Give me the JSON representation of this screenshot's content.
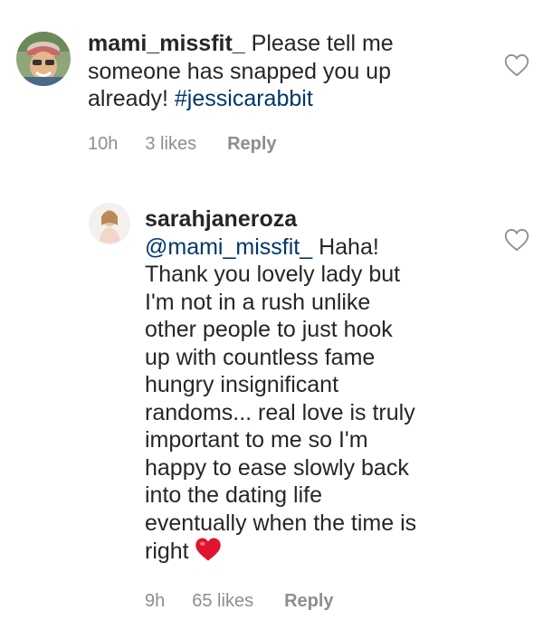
{
  "comments": [
    {
      "username": "mami_missfit_",
      "text_before_tag": "Please tell me",
      "text_line2": "someone has snapped you up",
      "text_line3_prefix": "already!",
      "hashtag": "#jessicarabbit",
      "time": "10h",
      "likes": "3 likes",
      "reply": "Reply"
    },
    {
      "username": "sarahjaneroza",
      "mention": "@mami_missfit_",
      "lines": [
        "Haha!",
        "Thank you lovely lady but",
        "I'm not in a rush unlike",
        "other people to just hook",
        "up with countless fame",
        "hungry insignificant",
        "randoms... real love is truly",
        "important to me so I'm",
        "happy to ease slowly back",
        "into the dating life",
        "eventually when the time is",
        "right"
      ],
      "time": "9h",
      "likes": "65 likes",
      "reply": "Reply"
    }
  ],
  "icons": {
    "like": "heart-outline-icon",
    "emoji": "red-heart-emoji"
  },
  "colors": {
    "text": "#262626",
    "meta": "#8e8e8e",
    "link": "#00376b",
    "emoji_heart": "#e0142f"
  }
}
